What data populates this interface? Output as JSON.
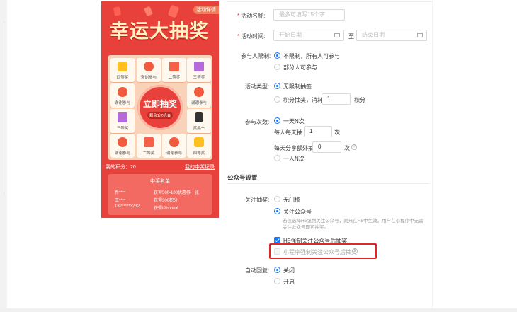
{
  "preview": {
    "rules_label": "活动详情",
    "title": "幸运大抽奖",
    "cells": [
      {
        "label": "四等奖",
        "icon": "yellow-gift-icon"
      },
      {
        "label": "谢谢参与",
        "icon": "red-heart-icon"
      },
      {
        "label": "二等奖",
        "icon": "red-envelope-icon"
      },
      {
        "label": "三等奖",
        "icon": "purple-gift-icon"
      },
      {
        "label": "谢谢参与",
        "icon": "red-heart-icon"
      },
      {
        "label": "谢谢参与",
        "icon": "red-heart-icon"
      },
      {
        "label": "三等奖",
        "icon": "purple-gift-icon"
      },
      {
        "label": "奖品一",
        "icon": "phone-icon"
      },
      {
        "label": "谢谢参与",
        "icon": "red-heart-icon"
      },
      {
        "label": "二等奖",
        "icon": "red-envelope-icon"
      },
      {
        "label": "谢谢参与",
        "icon": "red-heart-icon"
      },
      {
        "label": "四等奖",
        "icon": "yellow-gift-icon"
      }
    ],
    "draw_button": "立即抽奖",
    "draw_chances": "剩余1次机会",
    "points": "我的积分：20",
    "my_records": "我的中奖纪录",
    "winners_title": "中奖名单",
    "winners": [
      {
        "name": "乔****",
        "prize": "获得500-100优惠券一张"
      },
      {
        "name": "王****",
        "prize": "获得300积分"
      },
      {
        "name": "182*****3232",
        "prize": "获得iPhoneX"
      }
    ]
  },
  "form": {
    "name_label": "活动名称:",
    "name_placeholder": "最多可填写15个字",
    "time_label": "活动时间:",
    "start_placeholder": "开始日期",
    "to_label": "至",
    "end_placeholder": "结束日期",
    "limit_label": "参与人限制:",
    "limit_opt1": "不限制，所有人可参与",
    "limit_opt2": "部分人可参与",
    "type_label": "活动类型:",
    "type_opt1": "无限制抽签",
    "type_opt2": "积分抽奖，消耗",
    "type_points_value": "1",
    "type_points_unit": "积分",
    "times_label": "参与次数:",
    "times_opt1": "一天N次",
    "daily_label": "每人每天抽",
    "daily_value": "1",
    "daily_unit": "次",
    "share_label": "每天分享额外抽",
    "share_value": "0",
    "share_unit": "次",
    "times_opt2": "一人N次",
    "section_title": "公众号设置",
    "follow_label": "关注抽奖:",
    "follow_opt1": "无门槛",
    "follow_opt2": "关注公众号",
    "follow_note": "若仅选择H5强制关注公众号，则只在H5中生效。用户在小程序中无需关注公众号即可抽奖。",
    "h5_force": "H5强制关注公众号后抽奖",
    "mini_force": "小程序强制关注公众号后抽奖",
    "reply_label": "自动回复:",
    "reply_opt1": "关闭",
    "reply_opt2": "开启"
  }
}
